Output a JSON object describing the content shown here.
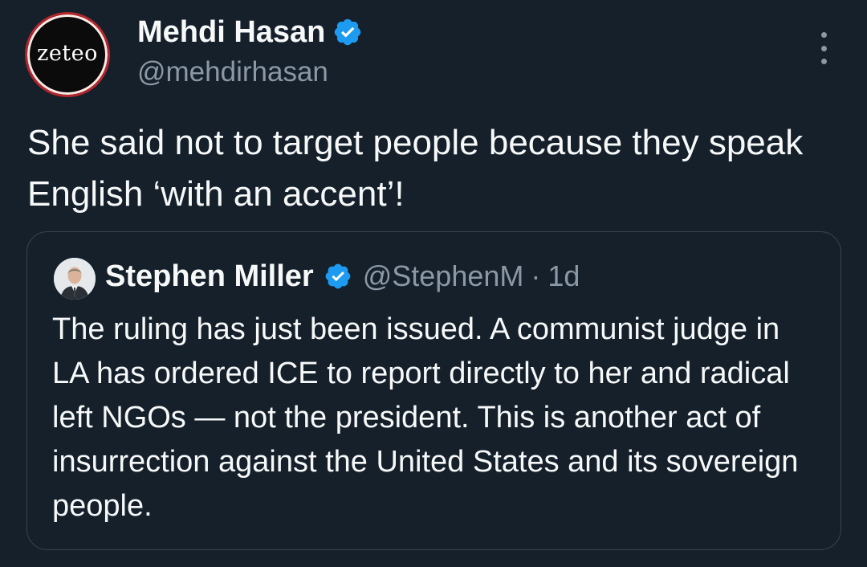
{
  "tweet": {
    "avatar_text": "zeteo",
    "display_name": "Mehdi Hasan",
    "handle": "@mehdirhasan",
    "text": "She said not to target people because they speak English ‘with an accent’!",
    "verified_icon": "verified-badge-icon",
    "more_icon": "more-options-icon"
  },
  "quote": {
    "display_name": "Stephen Miller",
    "handle": "@StephenM",
    "separator": "·",
    "time": "1d",
    "text": "The ruling has just been issued. A communist judge in LA has ordered ICE to report directly to her and radical left NGOs — not the president. This is another act of insurrection against the United States and its sovereign people.",
    "verified_icon": "verified-badge-icon",
    "avatar_icon": "profile-photo"
  },
  "colors": {
    "background": "#15202b",
    "text": "#f7f9f9",
    "secondary_text": "#8b98a5",
    "verified_blue": "#1d9bf0",
    "card_border": "#38444d",
    "avatar_ring": "#b3262d"
  }
}
